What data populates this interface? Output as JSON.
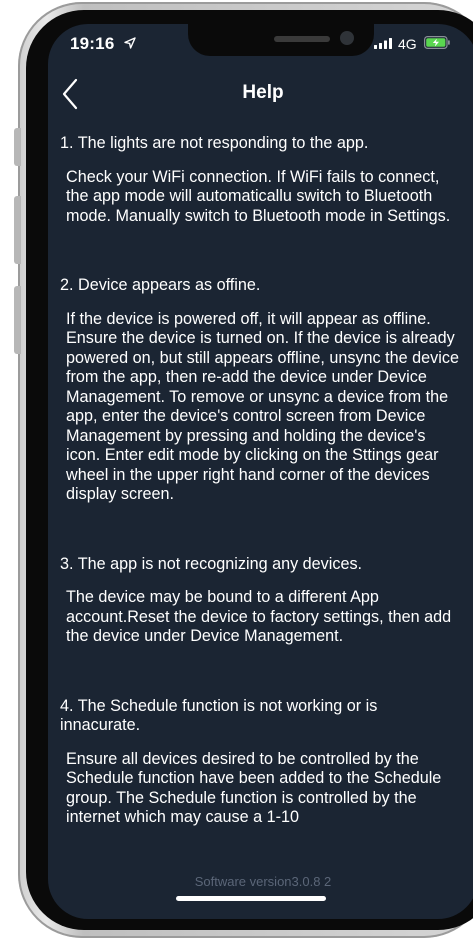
{
  "status_bar": {
    "time": "19:16",
    "network": "4G"
  },
  "header": {
    "title": "Help"
  },
  "faqs": [
    {
      "question": "1. The lights are not responding to the app.",
      "answer": "Check your WiFi connection. If WiFi fails to connect, the app mode will automaticallu switch to Bluetooth mode. Manually switch to Bluetooth mode in Settings."
    },
    {
      "question": "2. Device appears as offine.",
      "answer": "If the device is powered off, it will appear as offline. Ensure the device is turned on. If the device is already powered on, but still appears offline, unsync the device from the app, then re-add the device under Device Management. To remove or unsync a device from the app, enter the device's control screen from Device Management by pressing and holding the device's icon. Enter edit mode by clicking on the Sttings gear wheel in the upper right hand corner of the devices display screen."
    },
    {
      "question": "3. The app is not recognizing any devices.",
      "answer": "The device may be bound to a different App account.Reset the device to factory settings, then add the device under Device Management."
    },
    {
      "question": "4. The Schedule function is not working or is innacurate.",
      "answer": "Ensure all devices desired to be controlled by the Schedule function have been added to the Schedule group. The Schedule function is controlled by the internet which may cause a 1-10"
    }
  ],
  "footer": {
    "version": "Software version3.0.8  2"
  },
  "colors": {
    "screen_background": "#1b2533",
    "text": "#ffffff",
    "version_text": "#5b6678"
  },
  "icons": {
    "back": "chevron-left-icon",
    "location": "location-arrow-icon",
    "signal": "cellular-signal-icon",
    "battery": "battery-charging-icon"
  }
}
